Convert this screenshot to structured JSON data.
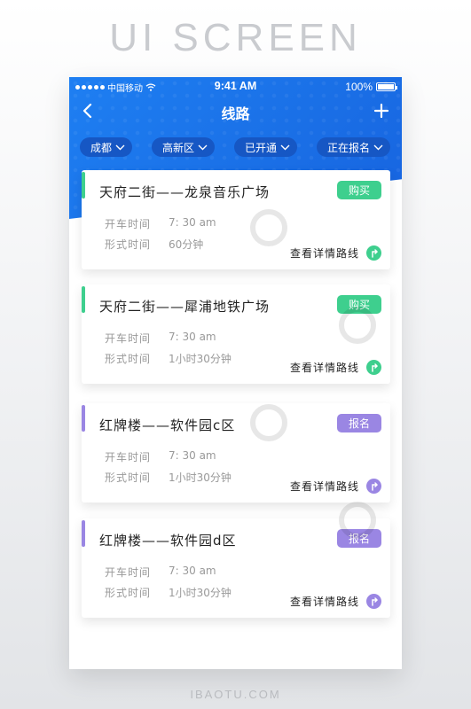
{
  "poster": {
    "title": "UI SCREEN",
    "footer": "IBAOTU.COM"
  },
  "status_bar": {
    "carrier": "中国移动",
    "time": "9:41 AM",
    "battery": "100%"
  },
  "nav": {
    "title": "线路",
    "back_icon": "chevron-left-icon",
    "add_icon": "plus-icon"
  },
  "filters": [
    {
      "label": "成都"
    },
    {
      "label": "高新区"
    },
    {
      "label": "已开通"
    },
    {
      "label": "正在报名"
    }
  ],
  "colors": {
    "primary": "#1e7ff2",
    "green": "#3ecf8e",
    "purple": "#9a86e3"
  },
  "routes": [
    {
      "title": "天府二街——龙泉音乐广场",
      "action": "购买",
      "depart_label": "开车时间",
      "depart_value": "7: 30 am",
      "duration_label": "形式时间",
      "duration_value": "60分钟",
      "link": "查看详情路线",
      "accent": "green"
    },
    {
      "title": "天府二街——犀浦地铁广场",
      "action": "购买",
      "depart_label": "开车时间",
      "depart_value": "7: 30 am",
      "duration_label": "形式时间",
      "duration_value": "1小时30分钟",
      "link": "查看详情路线",
      "accent": "green"
    },
    {
      "title": "红牌楼——软件园c区",
      "action": "报名",
      "depart_label": "开车时间",
      "depart_value": "7: 30 am",
      "duration_label": "形式时间",
      "duration_value": "1小时30分钟",
      "link": "查看详情路线",
      "accent": "purple"
    },
    {
      "title": "红牌楼——软件园d区",
      "action": "报名",
      "depart_label": "开车时间",
      "depart_value": "7: 30 am",
      "duration_label": "形式时间",
      "duration_value": "1小时30分钟",
      "link": "查看详情路线",
      "accent": "purple"
    }
  ]
}
